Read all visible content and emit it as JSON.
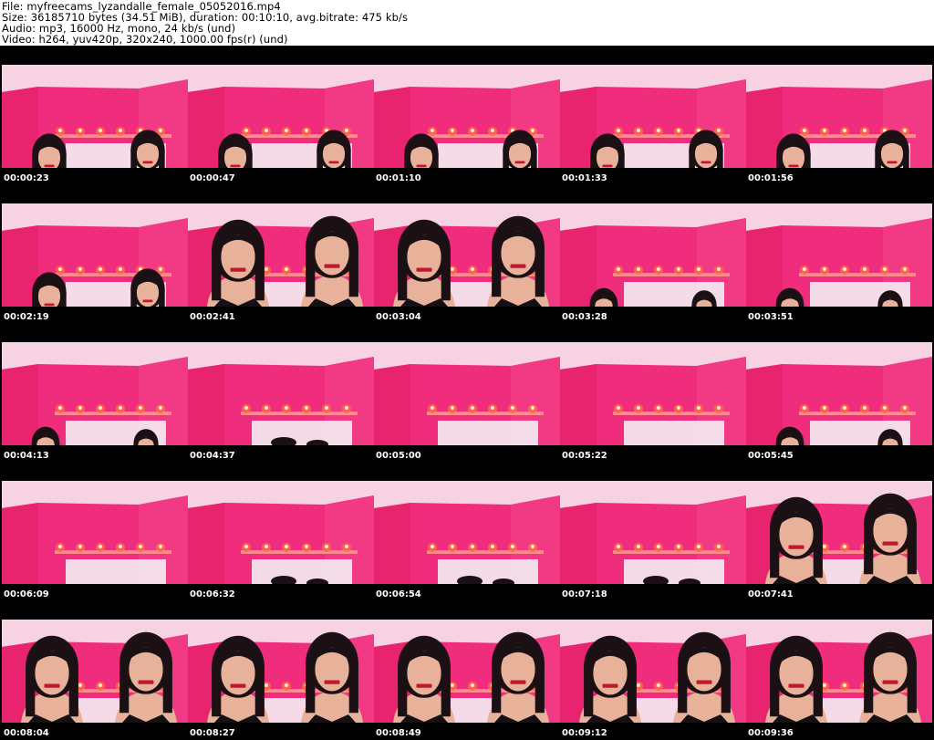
{
  "header": {
    "file_line": "File: myfreecams_lyzandalle_female_05052016.mp4",
    "size_line": "Size: 36185710 bytes (34.51 MiB), duration: 00:10:10, avg.bitrate: 475 kb/s",
    "audio_line": "Audio: mp3, 16000 Hz, mono, 24 kb/s (und)",
    "video_line": "Video: h264, yuv420p, 320x240, 1000.00 fps(r) (und)"
  },
  "colors": {
    "wall": "#f02d7c",
    "ceiling": "#f6d2e2",
    "shelf_glow": "#ff6a4a",
    "hair": "#1b1014",
    "skin": "#e8b19a",
    "top": "#151015",
    "bed": "#f4eef3"
  },
  "frames": [
    {
      "time": "00:00:23",
      "scene": "faces_low"
    },
    {
      "time": "00:00:47",
      "scene": "faces_low"
    },
    {
      "time": "00:01:10",
      "scene": "faces_low"
    },
    {
      "time": "00:01:33",
      "scene": "faces_low"
    },
    {
      "time": "00:01:56",
      "scene": "faces_low"
    },
    {
      "time": "00:02:19",
      "scene": "faces_low"
    },
    {
      "time": "00:02:41",
      "scene": "two_women"
    },
    {
      "time": "00:03:04",
      "scene": "two_women"
    },
    {
      "time": "00:03:28",
      "scene": "heads_bottom"
    },
    {
      "time": "00:03:51",
      "scene": "heads_bottom"
    },
    {
      "time": "00:04:13",
      "scene": "heads_bottom"
    },
    {
      "time": "00:04:37",
      "scene": "hair_tops"
    },
    {
      "time": "00:05:00",
      "scene": "empty"
    },
    {
      "time": "00:05:22",
      "scene": "empty"
    },
    {
      "time": "00:05:45",
      "scene": "heads_bottom"
    },
    {
      "time": "00:06:09",
      "scene": "empty"
    },
    {
      "time": "00:06:32",
      "scene": "hair_tops"
    },
    {
      "time": "00:06:54",
      "scene": "hair_tops"
    },
    {
      "time": "00:07:18",
      "scene": "hair_tops"
    },
    {
      "time": "00:07:41",
      "scene": "two_women"
    },
    {
      "time": "00:08:04",
      "scene": "two_women"
    },
    {
      "time": "00:08:27",
      "scene": "two_women"
    },
    {
      "time": "00:08:49",
      "scene": "two_women"
    },
    {
      "time": "00:09:12",
      "scene": "two_women"
    },
    {
      "time": "00:09:36",
      "scene": "two_women"
    }
  ]
}
